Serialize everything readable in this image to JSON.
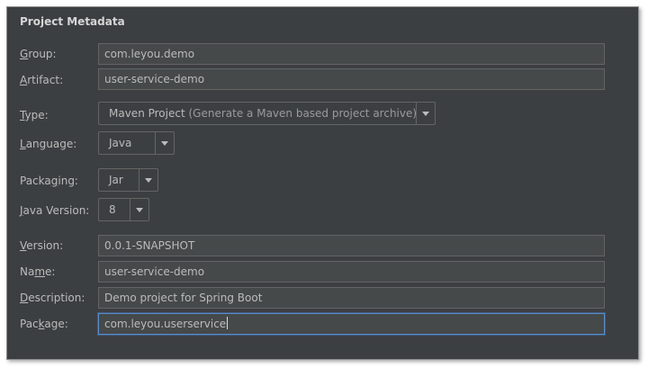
{
  "section_title": "Project Metadata",
  "fields": {
    "group": {
      "mnemonic": "G",
      "label_rest": "roup:",
      "value": "com.leyou.demo"
    },
    "artifact": {
      "mnemonic": "A",
      "label_rest": "rtifact:",
      "value": "user-service-demo"
    },
    "version": {
      "mnemonic": "V",
      "label_rest": "ersion:",
      "value": "0.0.1-SNAPSHOT"
    },
    "name": {
      "label_pre": "Na",
      "mnemonic": "m",
      "label_rest": "e:",
      "value": "user-service-demo"
    },
    "description": {
      "mnemonic": "D",
      "label_rest": "escription:",
      "value": "Demo project for Spring Boot"
    },
    "package": {
      "label_pre": "Pac",
      "mnemonic": "k",
      "label_rest": "age:",
      "value": "com.leyou.userservice"
    }
  },
  "combos": {
    "type": {
      "mnemonic": "T",
      "label_rest": "ype:",
      "value": "Maven Project",
      "hint": "(Generate a Maven based project archive)"
    },
    "language": {
      "mnemonic": "L",
      "label_rest": "anguage:",
      "value": "Java"
    },
    "packaging": {
      "label_pre": "Packa",
      "mnemonic": "g",
      "label_rest": "ing:",
      "value": "Jar"
    },
    "java_version": {
      "mnemonic": "J",
      "label_rest": "ava Version:",
      "value": "8"
    }
  },
  "icons": {
    "dropdown": "chevron-down-icon"
  },
  "colors": {
    "panel_bg": "#3c3f41",
    "field_bg": "#45494a",
    "border": "#646464",
    "text": "#bbbbbb",
    "focus": "#5a8cc8"
  }
}
